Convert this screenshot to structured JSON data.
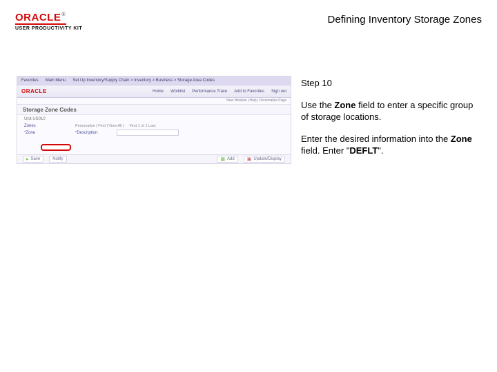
{
  "brand": {
    "logo": "ORACLE",
    "registered": "®",
    "subline": "USER PRODUCTIVITY KIT"
  },
  "page_title": "Defining Inventory Storage Zones",
  "step_label": "Step 10",
  "instruction_1_pre": "Use the ",
  "instruction_1_bold": "Zone",
  "instruction_1_post": " field to enter a specific group of storage locations.",
  "instruction_2_pre": "Enter the desired information into the ",
  "instruction_2_bold": "Zone",
  "instruction_2_mid": " field. Enter \"",
  "instruction_2_bold2": "DEFLT",
  "instruction_2_post": "\".",
  "ss": {
    "top_left": [
      "Favorites",
      "Main Menu"
    ],
    "top_breadcrumb": "Set Up Inventory/Supply Chain > Inventory > Business > Storage Area Codes",
    "top_right": [
      "Home",
      "Worklist",
      "Performance Trace",
      "Add to Favorites",
      "Sign out"
    ],
    "logo": "ORACLE",
    "bar2_links": [
      "New Window",
      "Help",
      "Personalize Page"
    ],
    "section_title": "Storage Zone Codes",
    "unit_label": "Unit  US010",
    "zones_label": "Zones",
    "zone_label": "*Zone",
    "desc_label": "*Description",
    "personalize": "Personalize | Find | View All |",
    "first_last": "First  1 of 1  Last",
    "foot_save": "Save",
    "foot_notify": "Notify",
    "foot_add": "Add",
    "foot_update": "Update/Display"
  }
}
